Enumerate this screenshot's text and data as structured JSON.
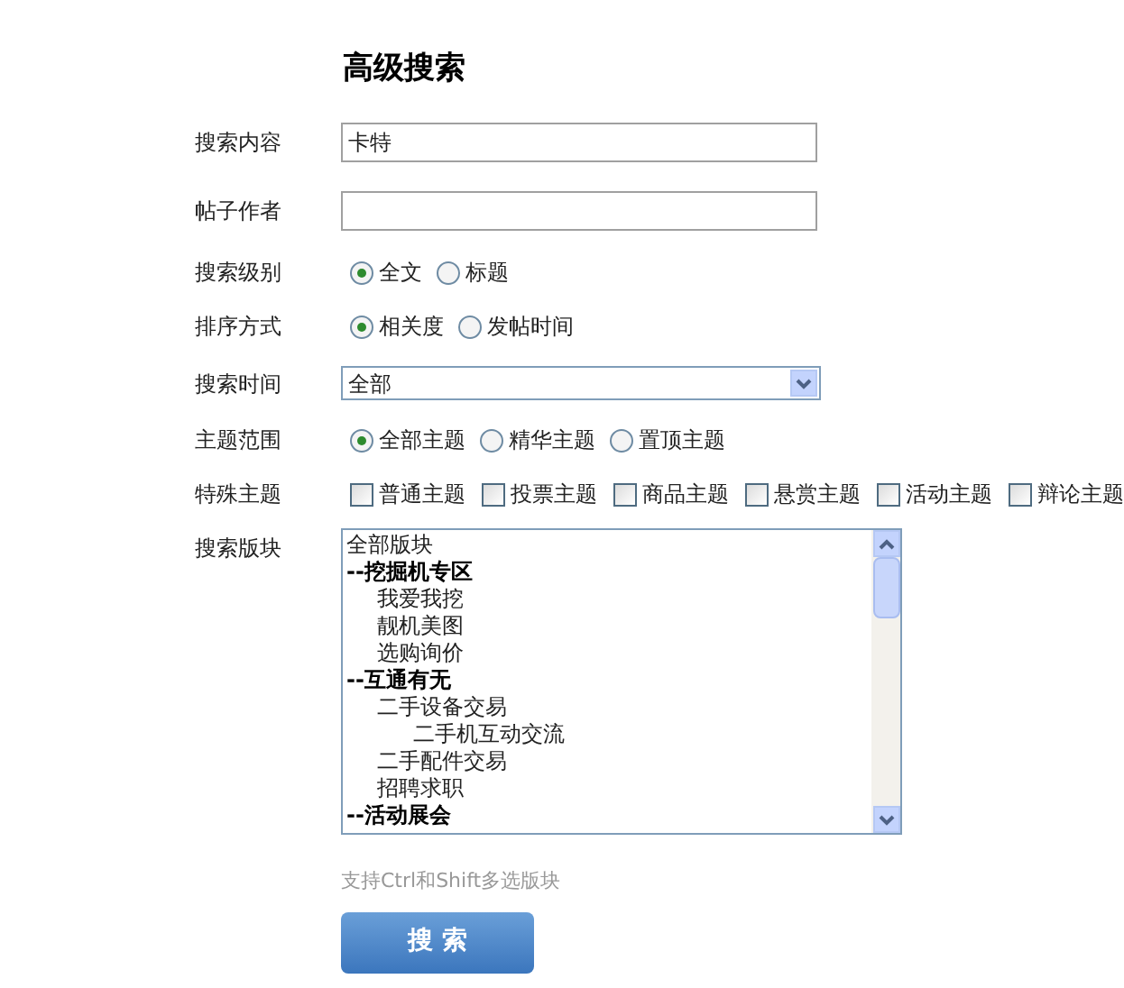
{
  "title": "高级搜索",
  "fields": [
    {
      "kind": "text",
      "label": "搜索内容",
      "value": "卡特"
    },
    {
      "kind": "text",
      "label": "帖子作者"
    },
    {
      "kind": "radio",
      "label": "搜索级别",
      "options": [
        {
          "label": "全文",
          "selected": true
        },
        {
          "label": "标题",
          "selected": false
        }
      ]
    },
    {
      "kind": "radio",
      "label": "排序方式",
      "options": [
        {
          "label": "相关度",
          "selected": true
        },
        {
          "label": "发帖时间",
          "selected": false
        }
      ]
    },
    {
      "kind": "select",
      "label": "搜索时间",
      "value": "全部"
    },
    {
      "kind": "radio",
      "label": "主题范围",
      "options": [
        {
          "label": "全部主题",
          "selected": true
        },
        {
          "label": "精华主题",
          "selected": false
        },
        {
          "label": "置顶主题",
          "selected": false
        }
      ]
    },
    {
      "kind": "checkbox",
      "label": "特殊主题",
      "options": [
        {
          "label": "普通主题",
          "checked": false
        },
        {
          "label": "投票主题",
          "checked": false
        },
        {
          "label": "商品主题",
          "checked": false
        },
        {
          "label": "悬赏主题",
          "checked": false
        },
        {
          "label": "活动主题",
          "checked": false
        },
        {
          "label": "辩论主题",
          "checked": false
        }
      ]
    },
    {
      "kind": "listbox",
      "label": "搜索版块",
      "items": [
        {
          "label": "全部版块",
          "kind": "all"
        },
        {
          "label": "--挖掘机专区",
          "kind": "group",
          "children": [
            {
              "label": "我爱我挖"
            },
            {
              "label": "靓机美图"
            },
            {
              "label": "选购询价"
            }
          ]
        },
        {
          "label": "--互通有无",
          "kind": "group",
          "children": [
            {
              "label": "二手设备交易",
              "children": [
                {
                  "label": "二手机互动交流"
                }
              ]
            },
            {
              "label": "二手配件交易"
            },
            {
              "label": "招聘求职"
            }
          ]
        },
        {
          "label": "--活动展会",
          "kind": "group"
        }
      ]
    }
  ],
  "hint": "支持Ctrl和Shift多选版块",
  "submit": "搜 索"
}
